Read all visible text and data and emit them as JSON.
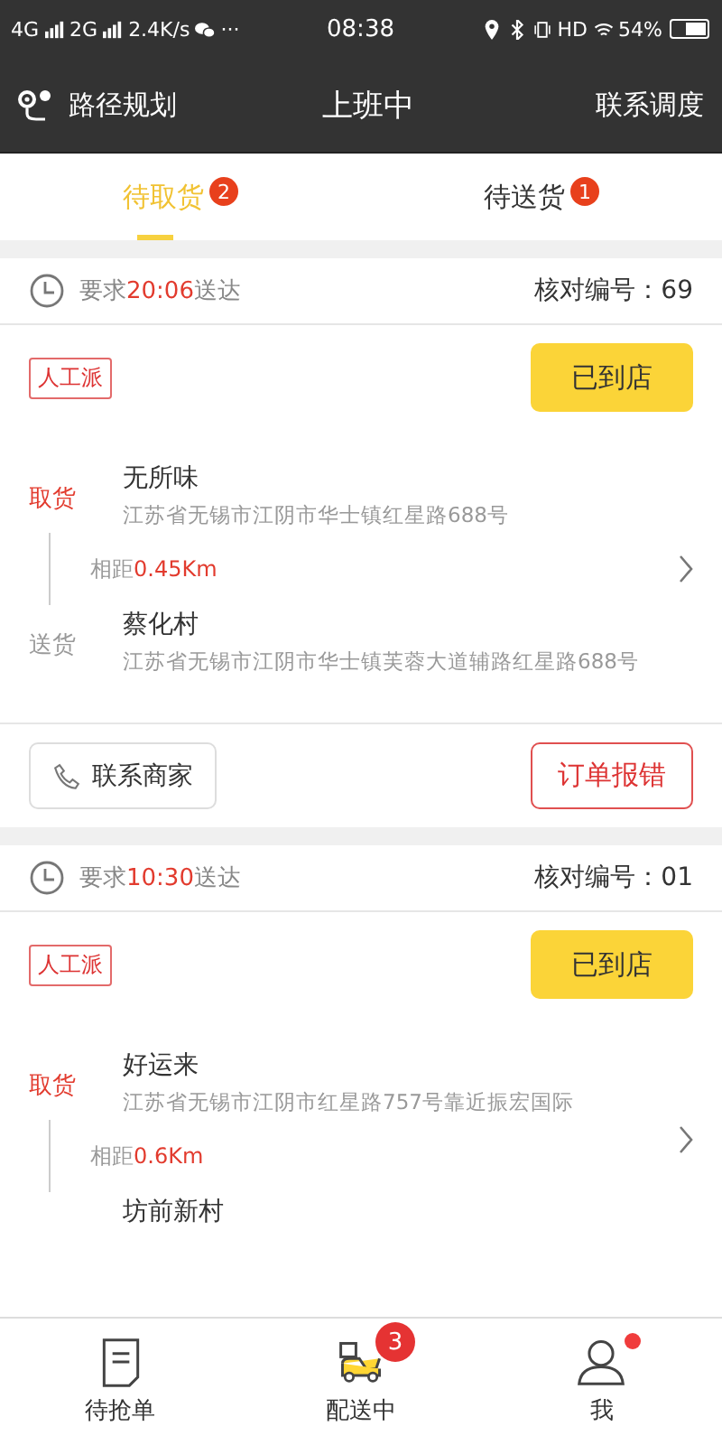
{
  "status_bar": {
    "left": [
      "4G",
      "2G",
      "2.4K/s",
      "···"
    ],
    "time": "08:38",
    "hd": "HD",
    "battery": "54%"
  },
  "header": {
    "left": "路径规划",
    "title": "上班中",
    "right": "联系调度"
  },
  "tabs": [
    {
      "label": "待取货",
      "badge": "2",
      "selected": true
    },
    {
      "label": "待送货",
      "badge": "1",
      "selected": false
    }
  ],
  "orders": [
    {
      "deadline_prefix": "要求",
      "deadline_time": "20:06",
      "deadline_suffix": "送达",
      "check_no": "核对编号：69",
      "tag": "人工派",
      "action": "已到店",
      "distance_label": "相距",
      "distance": "0.45Km",
      "stops": [
        {
          "kind": "pickup",
          "label": "取货",
          "name": "无所味",
          "address": "江苏省无锡市江阴市华士镇红星路688号"
        },
        {
          "kind": "delivery",
          "label": "送货",
          "name": "蔡化村",
          "address": "江苏省无锡市江阴市华士镇芙蓉大道辅路红星路688号"
        }
      ],
      "footer": {
        "contact": "联系商家",
        "report": "订单报错"
      }
    },
    {
      "deadline_prefix": "要求",
      "deadline_time": "10:30",
      "deadline_suffix": "送达",
      "check_no": "核对编号：01",
      "tag": "人工派",
      "action": "已到店",
      "distance_label": "相距",
      "distance": "0.6Km",
      "stops": [
        {
          "kind": "pickup",
          "label": "取货",
          "name": "好运来",
          "address": "江苏省无锡市江阴市红星路757号靠近振宏国际"
        },
        {
          "kind": "delivery",
          "name": "坊前新村"
        }
      ]
    }
  ],
  "nav": [
    {
      "kind": "document",
      "label": "待抢单",
      "selected": false
    },
    {
      "kind": "scooter",
      "label": "配送中",
      "badge": "3",
      "selected": true
    },
    {
      "kind": "person",
      "label": "我",
      "dot": true,
      "selected": false
    }
  ]
}
